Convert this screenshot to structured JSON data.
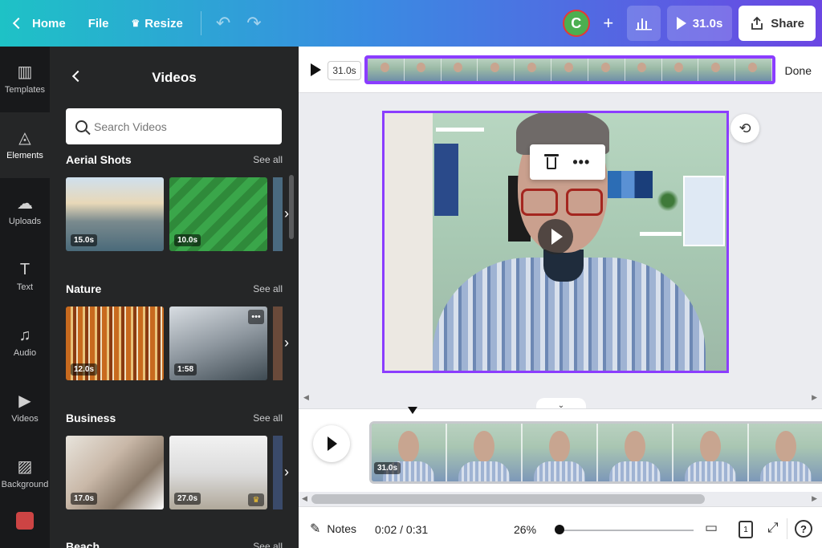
{
  "topbar": {
    "home_label": "Home",
    "file_label": "File",
    "resize_label": "Resize",
    "avatar_initial": "C",
    "play_duration": "31.0s",
    "share_label": "Share",
    "gradient_start": "#1ec2c6",
    "gradient_end": "#6b46e3"
  },
  "leftnav": {
    "items": [
      {
        "label": "Templates",
        "icon": "template-icon"
      },
      {
        "label": "Elements",
        "icon": "shapes-icon"
      },
      {
        "label": "Uploads",
        "icon": "upload-cloud-icon"
      },
      {
        "label": "Text",
        "icon": "text-icon"
      },
      {
        "label": "Audio",
        "icon": "music-note-icon"
      },
      {
        "label": "Videos",
        "icon": "video-icon"
      },
      {
        "label": "Background",
        "icon": "background-pattern-icon"
      }
    ]
  },
  "panel": {
    "title": "Videos",
    "search_placeholder": "Search Videos",
    "sections": [
      {
        "title": "Aerial Shots",
        "see_all": "See all",
        "durations": [
          "15.0s",
          "10.0s"
        ]
      },
      {
        "title": "Nature",
        "see_all": "See all",
        "durations": [
          "12.0s",
          "1:58"
        ]
      },
      {
        "title": "Business",
        "see_all": "See all",
        "durations": [
          "17.0s",
          "27.0s"
        ]
      },
      {
        "title": "Beach",
        "see_all": "See all"
      }
    ]
  },
  "editor": {
    "strip_duration": "31.0s",
    "done_label": "Done",
    "accent_color": "#8b3dff",
    "more_label": "•••",
    "collapse_label": "‹",
    "expand_label": "⌄",
    "timeline_duration": "31.0s"
  },
  "footer": {
    "notes_label": "Notes",
    "time": "0:02 / 0:31",
    "zoom": "26%",
    "page_number": "1",
    "help": "?"
  }
}
